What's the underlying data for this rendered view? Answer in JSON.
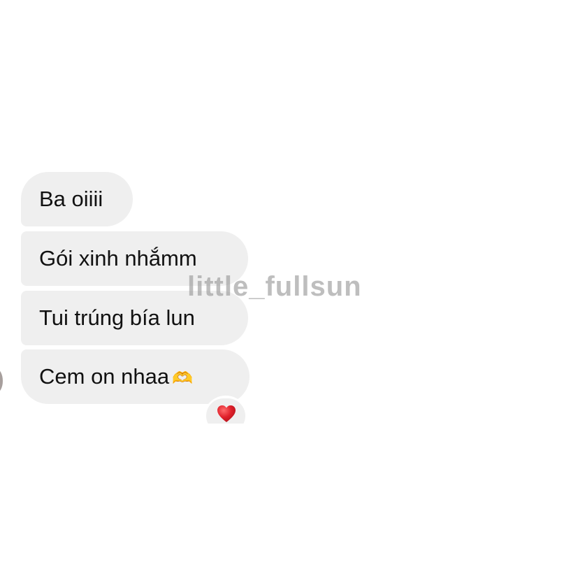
{
  "messages": [
    {
      "text": "Ba oiiii"
    },
    {
      "text": "Gói xinh nhắmm"
    },
    {
      "text": "Tui trúng bía lun"
    },
    {
      "text": "Cem on nhaa",
      "emoji": "🫶"
    }
  ],
  "reaction": {
    "icon": "heart-icon",
    "color": "#e0202a"
  },
  "watermark": "little_fullsun",
  "colors": {
    "bubble": "#efefef",
    "text": "#111111",
    "background": "#ffffff"
  }
}
